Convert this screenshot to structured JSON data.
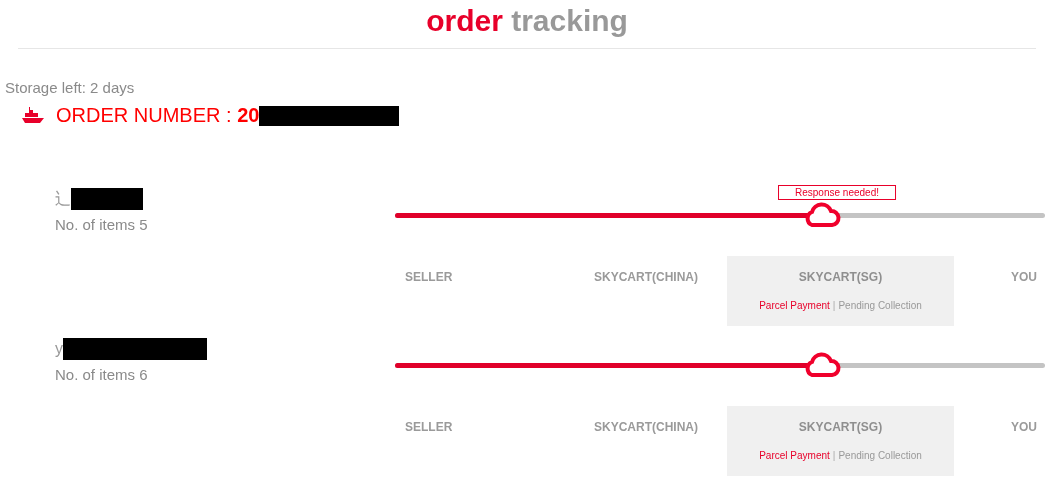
{
  "header": {
    "title_accent": "order",
    "title_rest": "tracking"
  },
  "storage": "Storage left: 2 days",
  "order": {
    "label": "ORDER NUMBER : ",
    "number": "20",
    "number_redacted": true
  },
  "shipments": [
    {
      "name": "辶",
      "name_redacted": true,
      "items": "No. of items 5",
      "level": 0.65,
      "tooltip": "Response needed!",
      "stages": [
        {
          "label": "SELLER",
          "selected": false
        },
        {
          "label": "SKYCART(CHINA)",
          "selected": false
        },
        {
          "label": "SKYCART(SG)",
          "selected": true,
          "status": [
            {
              "text": "Parcel Payment",
              "kind": "alert"
            },
            {
              "text": "|",
              "kind": "separator"
            },
            {
              "text": "Pending Collection",
              "kind": "pending"
            }
          ]
        },
        {
          "label": "YOU",
          "selected": false
        }
      ]
    },
    {
      "name": "y",
      "name_redacted": true,
      "items": "No. of items 6",
      "level": 0.65,
      "stages": [
        {
          "label": "SELLER",
          "selected": false
        },
        {
          "label": "SKYCART(CHINA)",
          "selected": false
        },
        {
          "label": "SKYCART(SG)",
          "selected": true,
          "status": [
            {
              "text": "Parcel Payment",
              "kind": "alert"
            },
            {
              "text": "|",
              "kind": "separator"
            },
            {
              "text": "Pending Collection",
              "kind": "pending"
            }
          ]
        },
        {
          "label": "YOU",
          "selected": false
        }
      ]
    }
  ]
}
